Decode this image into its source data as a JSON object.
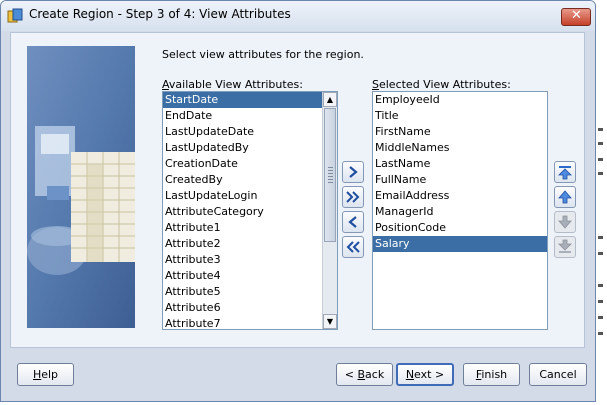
{
  "window": {
    "title": "Create Region - Step 3 of 4: View Attributes"
  },
  "instruction": "Select view attributes for the region.",
  "available": {
    "label_prefix": "",
    "label_mnemonic": "A",
    "label_rest": "vailable View Attributes:",
    "items": [
      "StartDate",
      "EndDate",
      "LastUpdateDate",
      "LastUpdatedBy",
      "CreationDate",
      "CreatedBy",
      "LastUpdateLogin",
      "AttributeCategory",
      "Attribute1",
      "Attribute2",
      "Attribute3",
      "Attribute4",
      "Attribute5",
      "Attribute6",
      "Attribute7"
    ],
    "selected_index": 0
  },
  "selected": {
    "label_prefix": "",
    "label_mnemonic": "S",
    "label_rest": "elected View Attributes:",
    "items": [
      "EmployeeId",
      "Title",
      "FirstName",
      "MiddleNames",
      "LastName",
      "FullName",
      "EmailAddress",
      "ManagerId",
      "PositionCode",
      "Salary"
    ],
    "selected_index": 9
  },
  "buttons": {
    "help_mnemonic": "H",
    "help_rest": "elp",
    "back_pre": "< ",
    "back_mnemonic": "B",
    "back_rest": "ack",
    "next_mnemonic": "N",
    "next_rest": "ext >",
    "finish_mnemonic": "F",
    "finish_rest": "inish",
    "cancel": "Cancel"
  },
  "colors": {
    "selection": "#3a6ea5",
    "close": "#c4402a",
    "accent": "#3f6bb8"
  }
}
